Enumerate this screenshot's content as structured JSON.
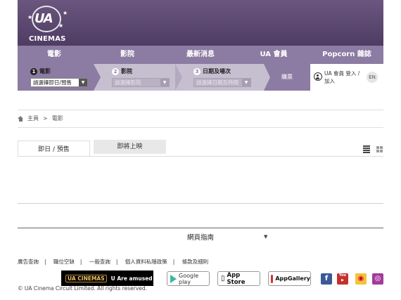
{
  "logo": {
    "mark": "UA",
    "name": "CINEMAS"
  },
  "nav": [
    "電影",
    "影院",
    "最新消息",
    "UA 會員",
    "Popcorn 雜誌"
  ],
  "steps": [
    {
      "num": "1",
      "label": "電影",
      "select": "請選擇即日/預售"
    },
    {
      "num": "2",
      "label": "影院",
      "select": "請選擇影院"
    },
    {
      "num": "3",
      "label": "日期及場次",
      "select": "請選擇日期及時間"
    }
  ],
  "buy_label": "購票",
  "member": {
    "login": "UA 會員 登入 / 加入",
    "lang": "EN"
  },
  "breadcrumb": {
    "home": "主頁",
    "sep": ">",
    "current": "電影"
  },
  "tabs": [
    {
      "label": "即日 / 預售",
      "active": true
    },
    {
      "label": "即將上映",
      "active": false
    }
  ],
  "footer": {
    "sitemap": "網頁指南",
    "links": [
      "廣告查詢",
      "職位空缺",
      "一般查詢",
      "個人資料私隱政策",
      "條款及細則"
    ],
    "ua_badge": [
      "UA CINEMAS",
      "U Are amused"
    ],
    "stores": [
      "Google play",
      "App Store",
      "AppGallery"
    ],
    "social_icons": [
      "facebook-icon",
      "youtube-icon",
      "weibo-icon",
      "instagram-icon"
    ],
    "copyright": "© UA Cinema Circuit Limited. All rights reserved."
  },
  "colors": {
    "header": "#5a4770",
    "nav": "#8c7ba2",
    "steps_bg": "#c6bfd0"
  }
}
